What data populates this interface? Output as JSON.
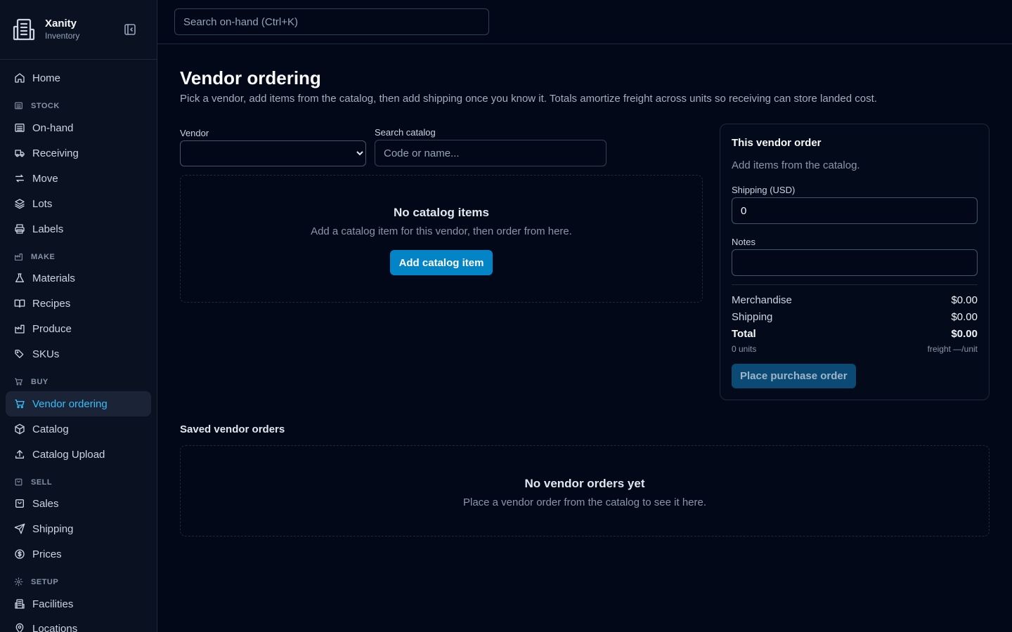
{
  "brand": {
    "name": "Xanity",
    "subtitle": "Inventory"
  },
  "topbar": {
    "search_placeholder": "Search on-hand (Ctrl+K)"
  },
  "nav": {
    "home": "Home",
    "sections": {
      "stock": "STOCK",
      "make": "MAKE",
      "buy": "BUY",
      "sell": "SELL",
      "setup": "SETUP"
    },
    "items": {
      "on_hand": "On-hand",
      "receiving": "Receiving",
      "move": "Move",
      "lots": "Lots",
      "labels": "Labels",
      "materials": "Materials",
      "recipes": "Recipes",
      "produce": "Produce",
      "skus": "SKUs",
      "vendor_ordering": "Vendor ordering",
      "catalog": "Catalog",
      "catalog_upload": "Catalog Upload",
      "sales": "Sales",
      "shipping": "Shipping",
      "prices": "Prices",
      "facilities": "Facilities",
      "locations": "Locations"
    }
  },
  "page": {
    "title": "Vendor ordering",
    "description": "Pick a vendor, add items from the catalog, then add shipping once you know it. Totals amortize freight across units so receiving can store landed cost."
  },
  "filters": {
    "vendor_label": "Vendor",
    "vendor_value": "",
    "catalog_label": "Search catalog",
    "catalog_placeholder": "Code or name..."
  },
  "catalog_empty": {
    "title": "No catalog items",
    "subtitle": "Add a catalog item for this vendor, then order from here.",
    "button": "Add catalog item"
  },
  "order": {
    "title": "This vendor order",
    "subtitle": "Add items from the catalog.",
    "shipping_label": "Shipping (USD)",
    "shipping_value": "0",
    "notes_label": "Notes",
    "notes_value": "",
    "merchandise_label": "Merchandise",
    "merchandise_value": "$0.00",
    "shipping_sum_label": "Shipping",
    "shipping_sum_value": "$0.00",
    "total_label": "Total",
    "total_value": "$0.00",
    "units": "0 units",
    "freight": "freight —/unit",
    "place_button": "Place purchase order"
  },
  "saved": {
    "title": "Saved vendor orders",
    "empty_title": "No vendor orders yet",
    "empty_subtitle": "Place a vendor order from the catalog to see it here."
  },
  "colors": {
    "accent": "#0284c7",
    "active_text": "#38bdf8",
    "background": "#020817"
  }
}
